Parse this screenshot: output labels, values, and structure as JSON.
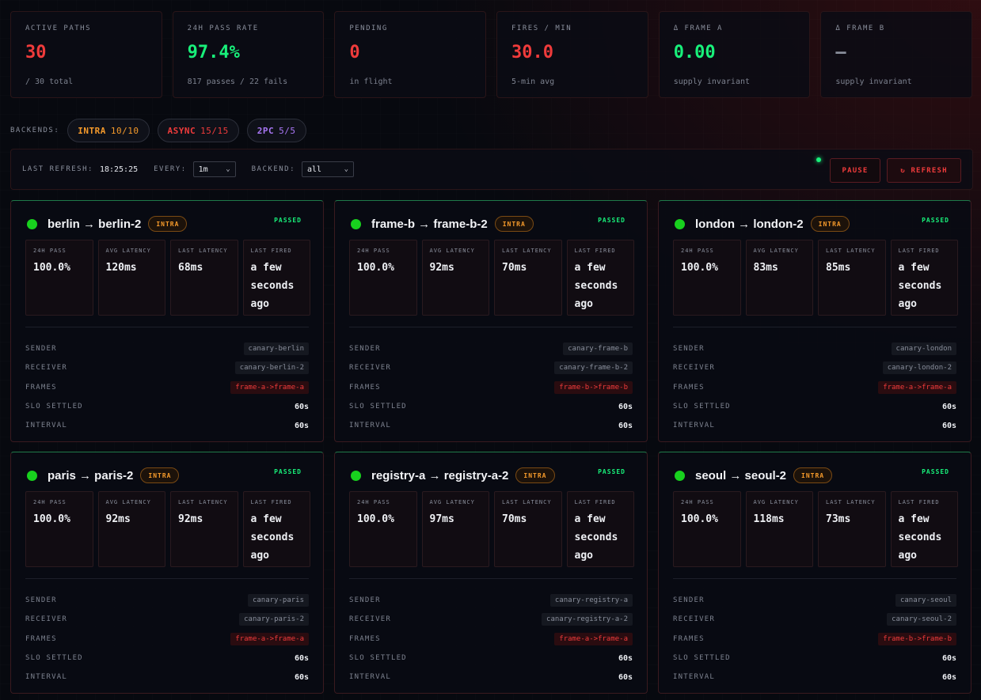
{
  "stats": [
    {
      "label": "ACTIVE PATHS",
      "value": "30",
      "sub": "/ 30 total",
      "color": "#ef3b3b"
    },
    {
      "label": "24H PASS RATE",
      "value": "97.4%",
      "sub": "817 passes / 22 fails",
      "color": "#18f07a"
    },
    {
      "label": "PENDING",
      "value": "0",
      "sub": "in flight",
      "color": "#ef3b3b"
    },
    {
      "label": "FIRES / MIN",
      "value": "30.0",
      "sub": "5-min avg",
      "color": "#ef3b3b"
    },
    {
      "label": "Δ FRAME A",
      "value": "0.00",
      "sub": "supply invariant",
      "color": "#18f07a"
    },
    {
      "label": "Δ FRAME B",
      "value": "—",
      "sub": "supply invariant",
      "color": "#8a8f9c"
    }
  ],
  "backends": {
    "label": "BACKENDS:",
    "chips": [
      {
        "name": "INTRA",
        "count": "10/10",
        "color": "#f59a2b"
      },
      {
        "name": "ASYNC",
        "count": "15/15",
        "color": "#ef3b3b"
      },
      {
        "name": "2PC",
        "count": "5/5",
        "color": "#a977f5"
      }
    ]
  },
  "toolbar": {
    "last_refresh_label": "LAST REFRESH:",
    "last_refresh_value": "18:25:25",
    "every_label": "EVERY:",
    "every_value": "1m",
    "backend_label": "BACKEND:",
    "backend_value": "all",
    "pause_label": "PAUSE",
    "refresh_label": "↻ REFRESH"
  },
  "labels": {
    "pass": "24H PASS",
    "avg": "AVG LATENCY",
    "last_lat": "LAST LATENCY",
    "last_fired": "LAST FIRED",
    "sender": "SENDER",
    "receiver": "RECEIVER",
    "frames": "FRAMES",
    "slo": "SLO SETTLED",
    "interval": "INTERVAL"
  },
  "cards": [
    {
      "title": "berlin → berlin-2",
      "badge": "INTRA",
      "status": "PASSED",
      "pass": "100.0%",
      "avg": "120ms",
      "last_lat": "68ms",
      "last_fired": "a few seconds ago",
      "sender": "canary-berlin",
      "receiver": "canary-berlin-2",
      "frames": "frame-a->frame-a",
      "slo": "60s",
      "interval": "60s"
    },
    {
      "title": "frame-b → frame-b-2",
      "badge": "INTRA",
      "status": "PASSED",
      "pass": "100.0%",
      "avg": "92ms",
      "last_lat": "70ms",
      "last_fired": "a few seconds ago",
      "sender": "canary-frame-b",
      "receiver": "canary-frame-b-2",
      "frames": "frame-b->frame-b",
      "slo": "60s",
      "interval": "60s"
    },
    {
      "title": "london → london-2",
      "badge": "INTRA",
      "status": "PASSED",
      "pass": "100.0%",
      "avg": "83ms",
      "last_lat": "85ms",
      "last_fired": "a few seconds ago",
      "sender": "canary-london",
      "receiver": "canary-london-2",
      "frames": "frame-a->frame-a",
      "slo": "60s",
      "interval": "60s"
    },
    {
      "title": "paris → paris-2",
      "badge": "INTRA",
      "status": "PASSED",
      "pass": "100.0%",
      "avg": "92ms",
      "last_lat": "92ms",
      "last_fired": "a few seconds ago",
      "sender": "canary-paris",
      "receiver": "canary-paris-2",
      "frames": "frame-a->frame-a",
      "slo": "60s",
      "interval": "60s"
    },
    {
      "title": "registry-a → registry-a-2",
      "badge": "INTRA",
      "status": "PASSED",
      "pass": "100.0%",
      "avg": "97ms",
      "last_lat": "70ms",
      "last_fired": "a few seconds ago",
      "sender": "canary-registry-a",
      "receiver": "canary-registry-a-2",
      "frames": "frame-a->frame-a",
      "slo": "60s",
      "interval": "60s"
    },
    {
      "title": "seoul → seoul-2",
      "badge": "INTRA",
      "status": "PASSED",
      "pass": "100.0%",
      "avg": "118ms",
      "last_lat": "73ms",
      "last_fired": "a few seconds ago",
      "sender": "canary-seoul",
      "receiver": "canary-seoul-2",
      "frames": "frame-b->frame-b",
      "slo": "60s",
      "interval": "60s"
    }
  ]
}
